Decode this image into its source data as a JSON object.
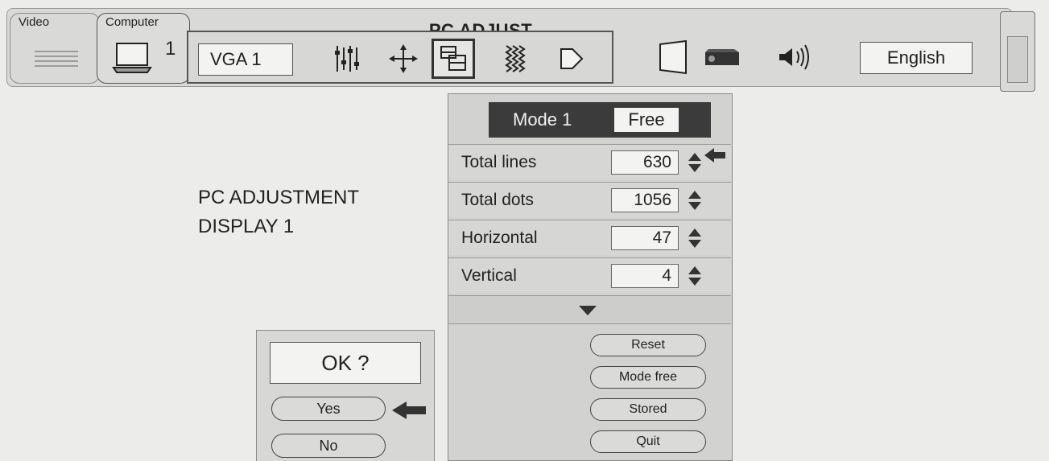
{
  "menu": {
    "title": "PC ADJUST",
    "source_tabs": [
      {
        "label": "Video",
        "icon": "video-source-icon"
      },
      {
        "label": "Computer",
        "icon": "laptop-icon",
        "number": "1"
      }
    ],
    "pc_group": {
      "input_name": "VGA 1",
      "icons": [
        "fine-sync-icon",
        "position-icon",
        "pc-adjust-icon",
        "image-level-icon",
        "screen-icon"
      ],
      "selected_icon": "pc-adjust-icon"
    },
    "right_icons": [
      "keystone-icon",
      "projector-icon",
      "sound-icon"
    ],
    "language": "English"
  },
  "display": {
    "line1": "PC ADJUSTMENT",
    "line2": "DISPLAY 1"
  },
  "panel": {
    "mode_label": "Mode 1",
    "mode_value": "Free",
    "params": [
      {
        "label": "Total lines",
        "value": "630",
        "pointer": true
      },
      {
        "label": "Total dots",
        "value": "1056",
        "pointer": false
      },
      {
        "label": "Horizontal",
        "value": "47",
        "pointer": false
      },
      {
        "label": "Vertical",
        "value": "4",
        "pointer": false
      }
    ],
    "buttons": [
      "Reset",
      "Mode free",
      "Stored",
      "Quit"
    ]
  },
  "dialog": {
    "question": "OK ?",
    "yes": "Yes",
    "no": "No"
  }
}
